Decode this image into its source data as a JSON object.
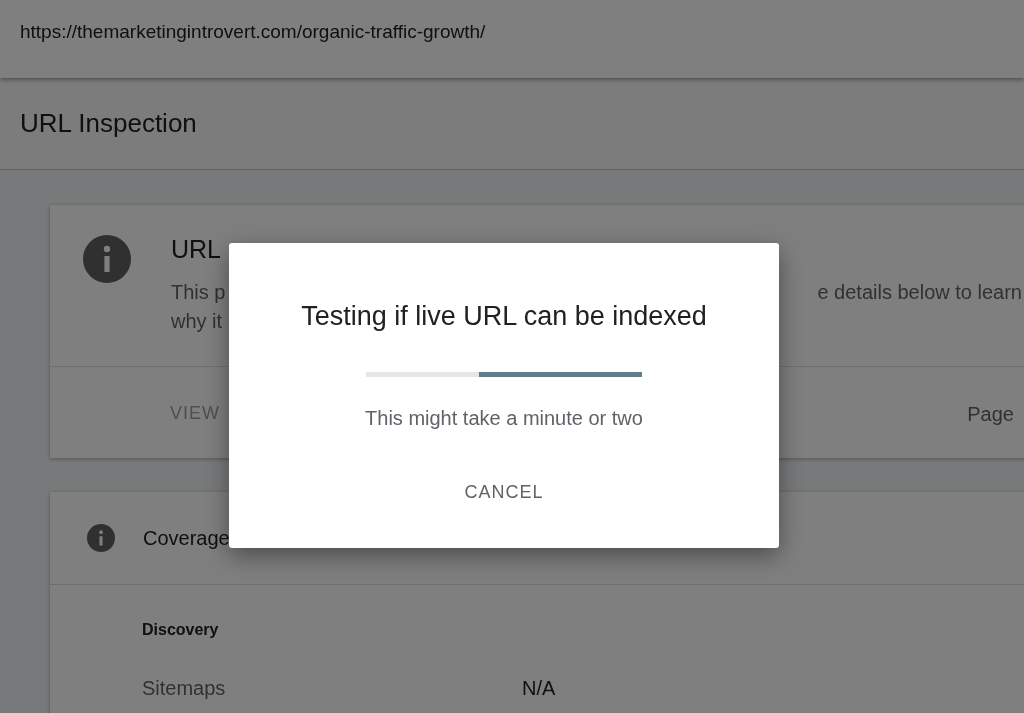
{
  "address_bar": {
    "url": "https://themarketingintrovert.com/organic-traffic-growth/"
  },
  "header": {
    "title": "URL Inspection"
  },
  "summary_card": {
    "title_visible": "URL",
    "description_line_1_left": "This p",
    "description_line_1_right": "e details below to learn",
    "description_line_2_left": "why it",
    "action_left": "VIEW",
    "action_right": "Page"
  },
  "coverage_card": {
    "row_label": "Coverage",
    "section_title": "Discovery",
    "rows": [
      {
        "label": "Sitemaps",
        "value": "N/A"
      }
    ]
  },
  "dialog": {
    "title": "Testing if live URL can be indexed",
    "progress": {
      "level": 0.59
    },
    "message": "This might take a minute or two",
    "buttons": [
      "CANCEL"
    ]
  }
}
